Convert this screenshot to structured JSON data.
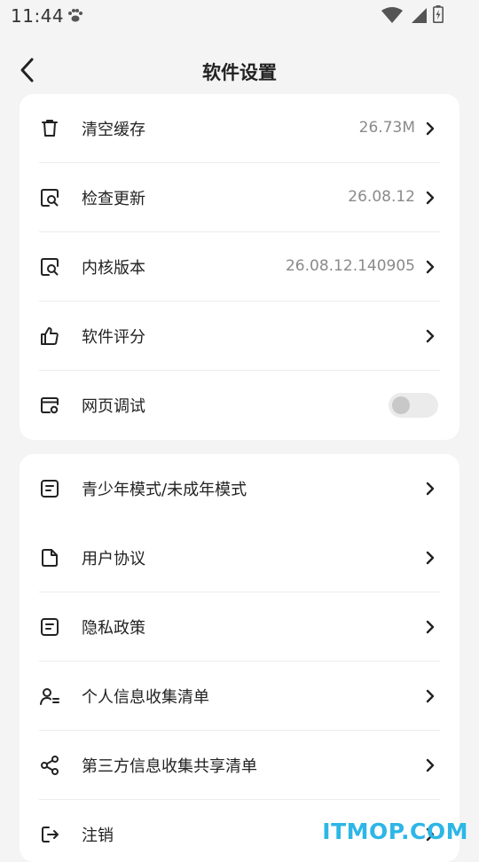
{
  "status": {
    "time": "11:44"
  },
  "header": {
    "title": "软件设置"
  },
  "card1": {
    "clear_cache": {
      "label": "清空缓存",
      "value": "26.73M"
    },
    "check_update": {
      "label": "检查更新",
      "value": "26.08.12"
    },
    "kernel_version": {
      "label": "内核版本",
      "value": "26.08.12.140905"
    },
    "rate_app": {
      "label": "软件评分"
    },
    "web_debug": {
      "label": "网页调试",
      "enabled": false
    }
  },
  "card2": {
    "teen_mode": {
      "label": "青少年模式/未成年模式"
    },
    "user_agreement": {
      "label": "用户协议"
    },
    "privacy_policy": {
      "label": "隐私政策"
    },
    "personal_info_list": {
      "label": "个人信息收集清单"
    },
    "third_party_list": {
      "label": "第三方信息收集共享清单"
    },
    "logout": {
      "label": "注销"
    }
  },
  "watermark": "ITMOP.COM"
}
